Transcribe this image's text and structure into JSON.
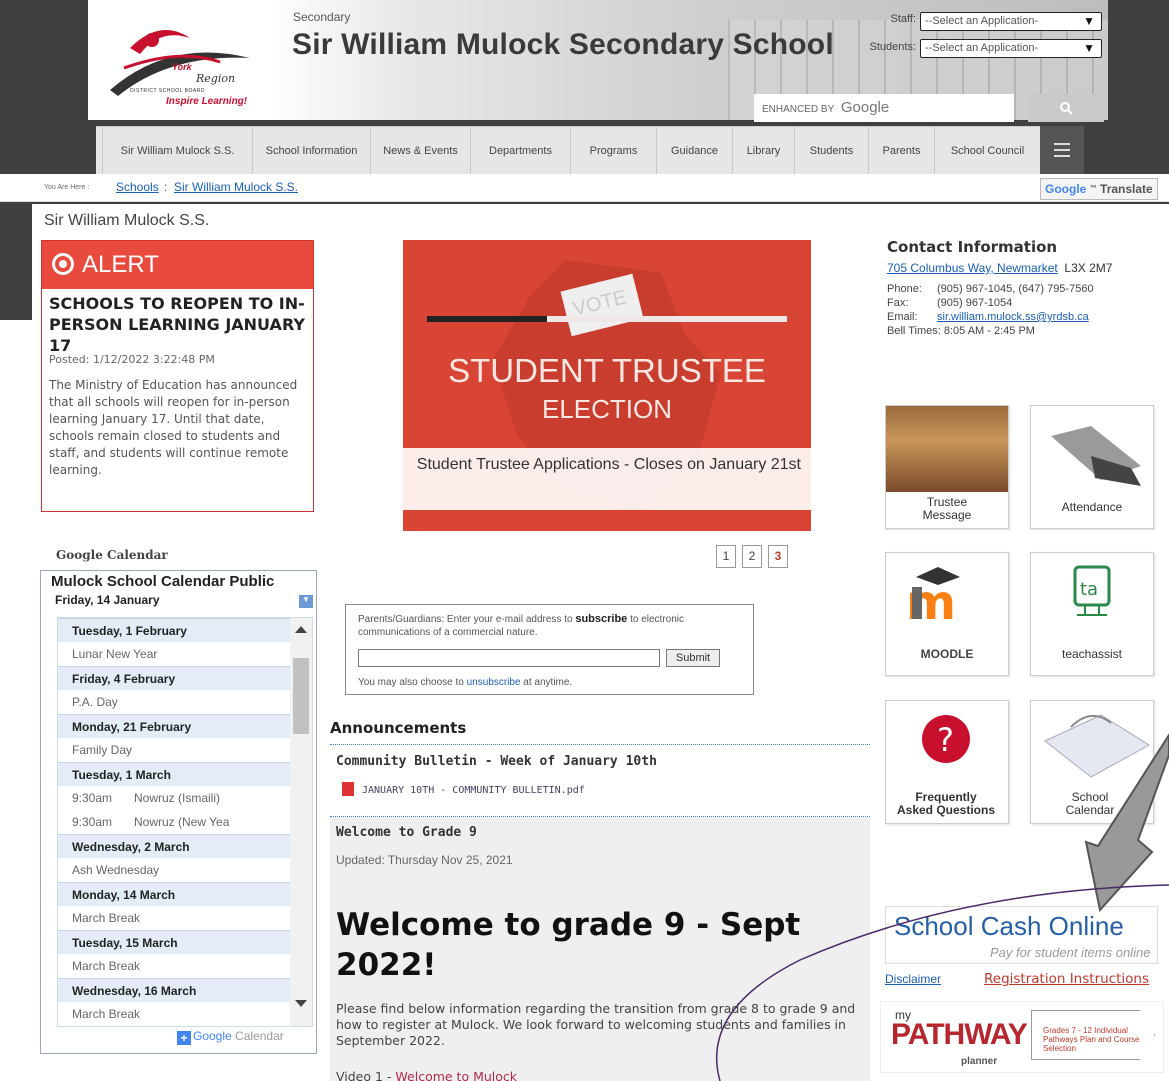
{
  "header": {
    "secondary_label": "Secondary",
    "school_name": "Sir William Mulock Secondary School",
    "logo": {
      "line1": "York",
      "line2": "Region",
      "line3": "DISTRICT SCHOOL BOARD",
      "tagline": "Inspire Learning!"
    },
    "staff_label": "Staff:",
    "staff_select": "--Select an Application-",
    "students_label": "Students:",
    "students_select": "--Select an Application-",
    "search_enhanced": "ENHANCED BY",
    "search_brand": "Google",
    "search_button_icon": "search-icon"
  },
  "nav": {
    "items": [
      "Sir William Mulock S.S.",
      "School Information",
      "News & Events",
      "Departments",
      "Programs",
      "Guidance",
      "Library",
      "Students",
      "Parents",
      "School Council"
    ],
    "menu_icon": "hamburger-icon"
  },
  "breadcrumb": {
    "you_are_here": "You Are Here :",
    "items": [
      "Schools",
      "Sir William Mulock S.S."
    ],
    "separator": ":"
  },
  "translate": {
    "brand": "Google",
    "label": "Translate"
  },
  "page_title": "Sir William Mulock S.S.",
  "alert": {
    "heading": "ALERT",
    "title": "SCHOOLS TO REOPEN TO IN-PERSON LEARNING JANUARY 17",
    "posted": "Posted: 1/12/2022 3:22:48 PM",
    "body": "The Ministry of Education has announced that all schools will reopen for in-person learning January 17. Until that date, schools remain closed to students and staff, and students will continue remote learning."
  },
  "calendar": {
    "section_label": "Google Calendar",
    "title": "Mulock School Calendar Public",
    "current_date": "Friday, 14 January",
    "rows": [
      {
        "type": "day",
        "text": "Tuesday, 1 February"
      },
      {
        "type": "ev",
        "time": "",
        "text": "Lunar New Year"
      },
      {
        "type": "day",
        "text": "Friday, 4 February"
      },
      {
        "type": "ev",
        "time": "",
        "text": "P.A. Day"
      },
      {
        "type": "day",
        "text": "Monday, 21 February"
      },
      {
        "type": "ev",
        "time": "",
        "text": "Family Day"
      },
      {
        "type": "day",
        "text": "Tuesday, 1 March"
      },
      {
        "type": "ev",
        "time": "9:30am",
        "text": "Nowruz (Ismaili)"
      },
      {
        "type": "ev",
        "time": "9:30am",
        "text": "Nowruz (New Yea"
      },
      {
        "type": "day",
        "text": "Wednesday, 2 March"
      },
      {
        "type": "ev",
        "time": "",
        "text": "Ash Wednesday"
      },
      {
        "type": "day",
        "text": "Monday, 14 March"
      },
      {
        "type": "ev",
        "time": "",
        "text": "March Break"
      },
      {
        "type": "day",
        "text": "Tuesday, 15 March"
      },
      {
        "type": "ev",
        "time": "",
        "text": "March Break"
      },
      {
        "type": "day",
        "text": "Wednesday, 16 March"
      },
      {
        "type": "ev",
        "time": "",
        "text": "March Break"
      }
    ],
    "badge_google": "Google",
    "badge_calendar": "Calendar"
  },
  "banner": {
    "ballot_text": "VOTE",
    "title": "STUDENT TRUSTEE",
    "subtitle": "ELECTION",
    "caption": "Student Trustee Applications - Closes on January 21st",
    "pages": [
      "1",
      "2",
      "3"
    ],
    "active_page": "3"
  },
  "subscribe": {
    "text_before": "Parents/Guardians: Enter your e-mail address to ",
    "text_bold": "subscribe",
    "text_after": " to electronic communications of a commercial nature.",
    "input_value": "",
    "button": "Submit",
    "also_before": "You may also choose to ",
    "also_link": "unsubscribe",
    "also_after": " at anytime."
  },
  "announcements": {
    "heading": "Announcements",
    "item1_title": "Community Bulletin - Week of January 10th",
    "item1_file": "JANUARY 10TH - COMMUNITY BULLETIN.pdf",
    "item2_title": "Welcome to Grade 9",
    "item2_updated": "Updated: Thursday Nov 25, 2021",
    "item2_heading": "Welcome to grade 9 - Sept 2022!",
    "item2_body": "Please find below information regarding the transition from grade 8 to grade 9 and how to register at Mulock.  We look forward to welcoming students and families in September 2022.",
    "item2_video_prefix": "Video 1 - ",
    "item2_video_link": "Welcome to Mulock"
  },
  "contact": {
    "heading": "Contact Information",
    "address_link": "705 Columbus Way, Newmarket",
    "postal": "L3X 2M7",
    "phone_label": "Phone:",
    "phone": "(905) 967-1045, (647) 795-7560",
    "fax_label": "Fax:",
    "fax": "(905) 967-1054",
    "email_label": "Email:",
    "email": "sir.william.mulock.ss@yrdsb.ca",
    "bell_times": "Bell Times: 8:05 AM - 2:45 PM"
  },
  "tiles": [
    {
      "label": "Trustee Message"
    },
    {
      "label": "Attendance"
    },
    {
      "label": "MOODLE"
    },
    {
      "label": "teachassist"
    },
    {
      "label": "Frequently Asked Questions"
    },
    {
      "label": "School Calendar"
    }
  ],
  "school_cash": {
    "logo": "School Cash Online",
    "tagline": "Pay for student items online"
  },
  "links": {
    "disclaimer": "Disclaimer",
    "registration": "Registration Instructions"
  },
  "pathway": {
    "my": "my",
    "name": "PATHWAY",
    "planner": "planner",
    "desc": "Grades 7 - 12 Individual Pathways Plan and Course Selection"
  },
  "colors": {
    "alert_red": "#e84a3d",
    "banner_red": "#d94535",
    "link_blue": "#1a5fb4",
    "nav_bg": "#e6e6e6"
  }
}
